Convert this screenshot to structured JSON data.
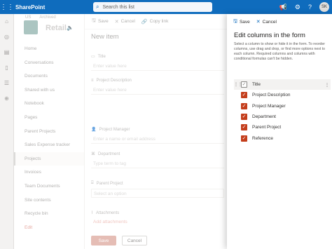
{
  "topbar": {
    "app_name": "SharePoint",
    "search_placeholder": "Search this list",
    "avatar_initials": "SK"
  },
  "site": {
    "breadcrumbs": [
      "US",
      "Archived"
    ],
    "name": "Retail"
  },
  "leftnav": {
    "items": [
      {
        "label": "Home"
      },
      {
        "label": "Conversations"
      },
      {
        "label": "Documents"
      },
      {
        "label": "Shared with us"
      },
      {
        "label": "Notebook"
      },
      {
        "label": "Pages"
      },
      {
        "label": "Parent Projects"
      },
      {
        "label": "Sales Expense tracker"
      },
      {
        "label": "Projects"
      },
      {
        "label": "Invoices"
      },
      {
        "label": "Team Documents"
      },
      {
        "label": "Site contents"
      },
      {
        "label": "Recycle bin"
      },
      {
        "label": "Edit"
      }
    ]
  },
  "form": {
    "cmd_save": "Save",
    "cmd_cancel": "Cancel",
    "cmd_copy": "Copy link",
    "title": "New item",
    "fields": [
      {
        "label": "Title",
        "placeholder": "Enter value here"
      },
      {
        "label": "Project Description",
        "placeholder": "Enter value here"
      },
      {
        "label": "Project Manager",
        "placeholder": "Enter a name or email address"
      },
      {
        "label": "Department",
        "placeholder": "Type term to tag"
      },
      {
        "label": "Parent Project",
        "placeholder": "Select an option"
      },
      {
        "label": "Attachments",
        "placeholder": "Add attachments"
      }
    ],
    "btn_save": "Save",
    "btn_cancel": "Cancel"
  },
  "panel": {
    "cmd_save": "Save",
    "cmd_cancel": "Cancel",
    "title": "Edit columns in the form",
    "description": "Select a column to show or hide it in the form. To reorder columns, use drag and drop, or find more options next to each column. Required columns and columns with conditional formulas can't be hidden.",
    "columns": [
      {
        "label": "Title",
        "checked": true,
        "locked": true
      },
      {
        "label": "Project Description",
        "checked": true
      },
      {
        "label": "Project Manager",
        "checked": true
      },
      {
        "label": "Department",
        "checked": true
      },
      {
        "label": "Parent Project",
        "checked": true
      },
      {
        "label": "Reference",
        "checked": true
      }
    ],
    "accent_color": "#c43e1c"
  }
}
